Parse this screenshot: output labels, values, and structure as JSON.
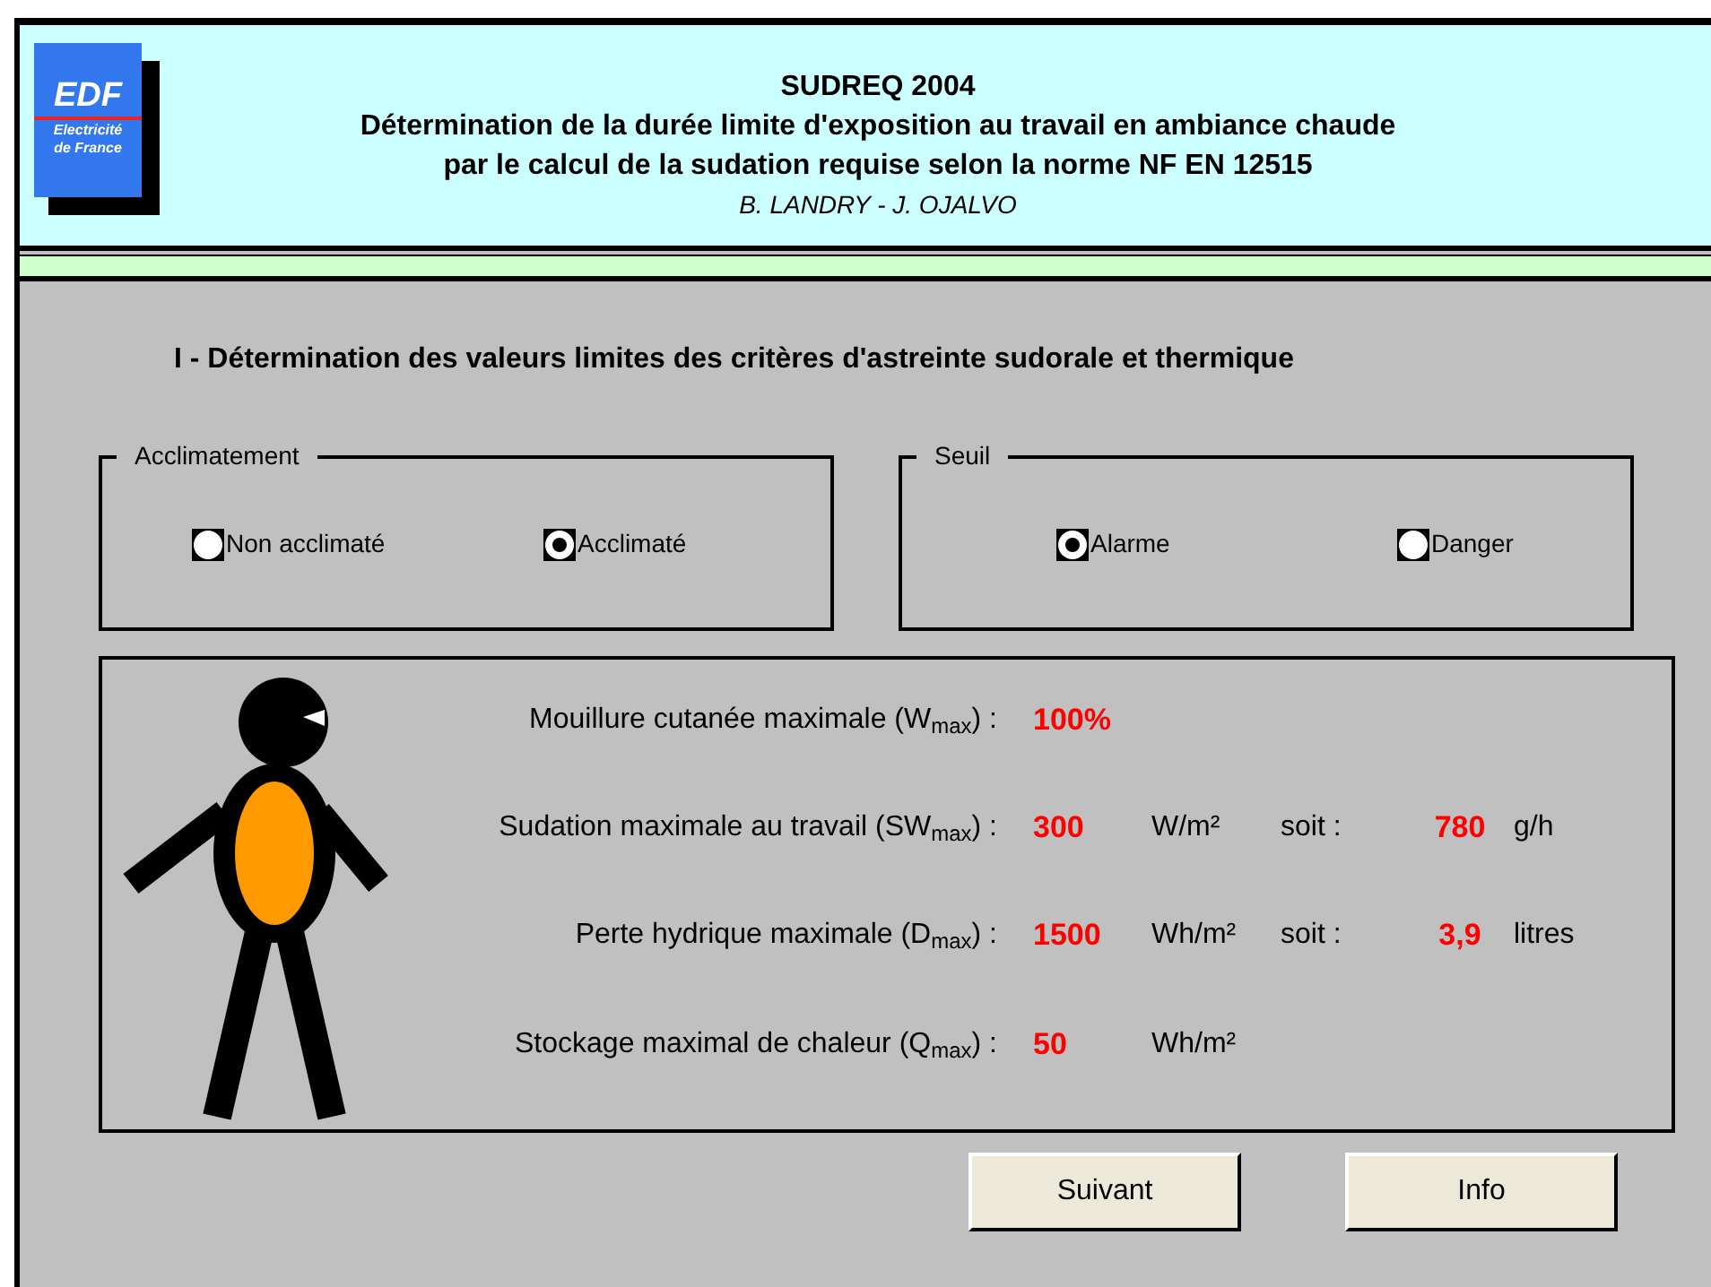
{
  "header": {
    "logo": {
      "main": "EDF",
      "sub_lines": [
        "Electricité",
        "de France"
      ]
    },
    "title": "SUDREQ 2004",
    "subtitle_lines": [
      "Détermination de la durée limite d'exposition au travail en ambiance chaude",
      "par le calcul de la sudation requise selon la norme NF EN 12515"
    ],
    "authors": "B. LANDRY - J. OJALVO"
  },
  "section_title": "I - Détermination des valeurs limites des critères d'astreinte sudorale et thermique",
  "groups": [
    {
      "legend": "Acclimatement",
      "options": [
        {
          "label": "Non acclimaté",
          "selected": false
        },
        {
          "label": "Acclimaté",
          "selected": true
        }
      ]
    },
    {
      "legend": "Seuil",
      "options": [
        {
          "label": "Alarme",
          "selected": true
        },
        {
          "label": "Danger",
          "selected": false
        }
      ]
    }
  ],
  "criteria": [
    {
      "label": "Mouillure cutanée maximale (W$_{max}$) :",
      "value": "100%"
    },
    {
      "label": "Sudation maximale au travail  (SW$_{max}$) :",
      "value": "300",
      "unit": "W/m²",
      "conversion_label": "soit :",
      "conversion_value": "780",
      "conversion_unit": "g/h"
    },
    {
      "label": "Perte hydrique maximale (D$_{max}$) :",
      "value": "1500",
      "unit": "Wh/m²",
      "conversion_label": "soit :",
      "conversion_value": "3,9",
      "conversion_unit": "litres"
    },
    {
      "label": "Stockage maximal de chaleur (Q$_{max}$) :",
      "value": "50",
      "unit": "Wh/m²"
    }
  ],
  "buttons": [
    "Suivant",
    "Info"
  ]
}
